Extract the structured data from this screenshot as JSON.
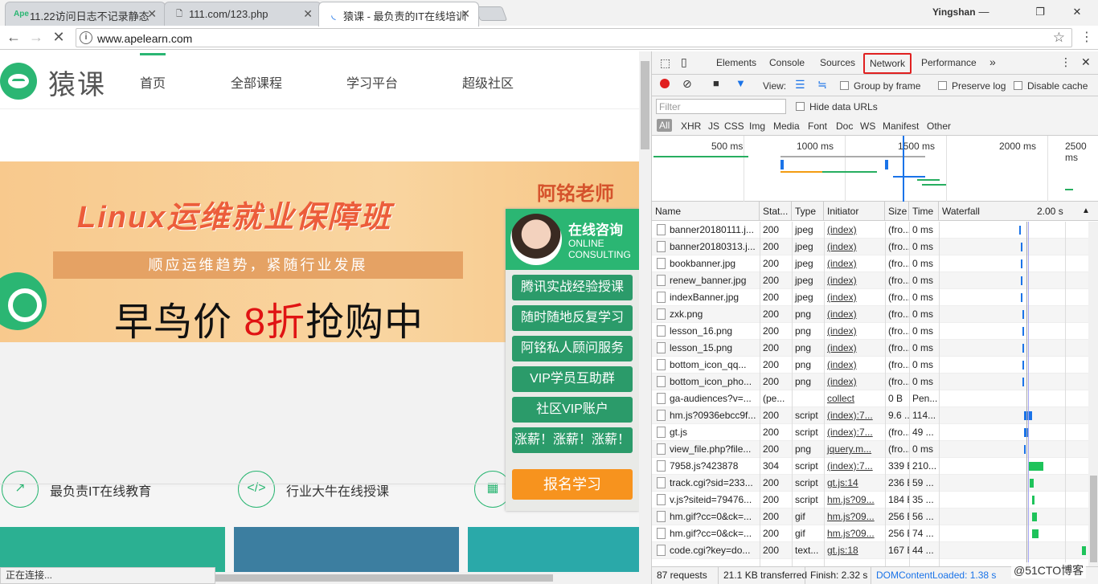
{
  "browser": {
    "tabs": [
      {
        "favicon": "Ape",
        "title": "11.22访问日志不记录静态"
      },
      {
        "favicon": "page-icon",
        "title": "111.com/123.php"
      },
      {
        "favicon": "loading-icon",
        "title": "猿课 - 最负责的IT在线培训"
      }
    ],
    "user": "Yingshan",
    "url": "www.apelearn.com",
    "status_text": "正在连接..."
  },
  "site": {
    "logo_text": "猿课",
    "nav": [
      "首页",
      "全部课程",
      "学习平台",
      "超级社区"
    ],
    "banner": {
      "title": "Linux运维就业保障班",
      "strip": "顺应运维趋势，紧随行业发展",
      "price_prefix": "早鸟价 ",
      "price_red": "8折",
      "price_suffix": "抢购中",
      "right_text": "阿铭老师"
    },
    "features": [
      "最负责IT在线教育",
      "行业大牛在线授课"
    ],
    "consult": {
      "title": "在线咨询",
      "subtitle": "ONLINE CONSULTING",
      "buttons": [
        "腾讯实战经验授课",
        "随时随地反复学习",
        "阿铭私人顾问服务",
        "VIP学员互助群",
        "社区VIP账户",
        "涨薪！涨薪！涨薪！"
      ],
      "cta": "报名学习"
    }
  },
  "devtools": {
    "tabs": [
      "Elements",
      "Console",
      "Sources",
      "Network",
      "Performance"
    ],
    "active_tab": "Network",
    "view_label": "View:",
    "group_by_frame": "Group by frame",
    "preserve_log": "Preserve log",
    "disable_cache": "Disable cache",
    "filter_placeholder": "Filter",
    "hide_data_urls": "Hide data URLs",
    "filter_types": [
      "All",
      "XHR",
      "JS",
      "CSS",
      "Img",
      "Media",
      "Font",
      "Doc",
      "WS",
      "Manifest",
      "Other"
    ],
    "overview_ticks": [
      "500 ms",
      "1000 ms",
      "1500 ms",
      "2000 ms",
      "2500 ms"
    ],
    "columns": [
      "Name",
      "Stat...",
      "Type",
      "Initiator",
      "Size",
      "Time",
      "Waterfall"
    ],
    "waterfall_tick": "2.00 s",
    "rows": [
      {
        "name": "banner20180111.j...",
        "status": "200",
        "type": "jpeg",
        "initiator": "(index)",
        "size": "(fro...",
        "time": "0 ms"
      },
      {
        "name": "banner20180313.j...",
        "status": "200",
        "type": "jpeg",
        "initiator": "(index)",
        "size": "(fro...",
        "time": "0 ms"
      },
      {
        "name": "bookbanner.jpg",
        "status": "200",
        "type": "jpeg",
        "initiator": "(index)",
        "size": "(fro...",
        "time": "0 ms"
      },
      {
        "name": "renew_banner.jpg",
        "status": "200",
        "type": "jpeg",
        "initiator": "(index)",
        "size": "(fro...",
        "time": "0 ms"
      },
      {
        "name": "indexBanner.jpg",
        "status": "200",
        "type": "jpeg",
        "initiator": "(index)",
        "size": "(fro...",
        "time": "0 ms"
      },
      {
        "name": "zxk.png",
        "status": "200",
        "type": "png",
        "initiator": "(index)",
        "size": "(fro...",
        "time": "0 ms"
      },
      {
        "name": "lesson_16.png",
        "status": "200",
        "type": "png",
        "initiator": "(index)",
        "size": "(fro...",
        "time": "0 ms"
      },
      {
        "name": "lesson_15.png",
        "status": "200",
        "type": "png",
        "initiator": "(index)",
        "size": "(fro...",
        "time": "0 ms"
      },
      {
        "name": "bottom_icon_qq...",
        "status": "200",
        "type": "png",
        "initiator": "(index)",
        "size": "(fro...",
        "time": "0 ms"
      },
      {
        "name": "bottom_icon_pho...",
        "status": "200",
        "type": "png",
        "initiator": "(index)",
        "size": "(fro...",
        "time": "0 ms"
      },
      {
        "name": "ga-audiences?v=...",
        "status": "(pe...",
        "type": "",
        "initiator": "collect",
        "size": "0 B",
        "time": "Pen..."
      },
      {
        "name": "hm.js?0936ebcc9f...",
        "status": "200",
        "type": "script",
        "initiator": "(index):7...",
        "size": "9.6 ...",
        "time": "114..."
      },
      {
        "name": "gt.js",
        "status": "200",
        "type": "script",
        "initiator": "(index):7...",
        "size": "(fro...",
        "time": "49 ..."
      },
      {
        "name": "view_file.php?file...",
        "status": "200",
        "type": "png",
        "initiator": "jquery.m...",
        "size": "(fro...",
        "time": "0 ms"
      },
      {
        "name": "7958.js?423878",
        "status": "304",
        "type": "script",
        "initiator": "(index):7...",
        "size": "339 B",
        "time": "210..."
      },
      {
        "name": "track.cgi?sid=233...",
        "status": "200",
        "type": "script",
        "initiator": "gt.js:14",
        "size": "236 B",
        "time": "59 ..."
      },
      {
        "name": "v.js?siteid=79476...",
        "status": "200",
        "type": "script",
        "initiator": "hm.js?09...",
        "size": "184 B",
        "time": "35 ..."
      },
      {
        "name": "hm.gif?cc=0&ck=...",
        "status": "200",
        "type": "gif",
        "initiator": "hm.js?09...",
        "size": "256 B",
        "time": "56 ..."
      },
      {
        "name": "hm.gif?cc=0&ck=...",
        "status": "200",
        "type": "gif",
        "initiator": "hm.js?09...",
        "size": "256 B",
        "time": "74 ..."
      },
      {
        "name": "code.cgi?key=do...",
        "status": "200",
        "type": "text...",
        "initiator": "gt.js:18",
        "size": "167 B",
        "time": "44 ..."
      }
    ],
    "summary": {
      "requests": "87 requests",
      "transferred": "21.1 KB transferred",
      "finish": "Finish: 2.32 s",
      "dom_loaded": "DOMContentLoaded: 1.38 s"
    }
  },
  "watermark": "@51CTO博客"
}
